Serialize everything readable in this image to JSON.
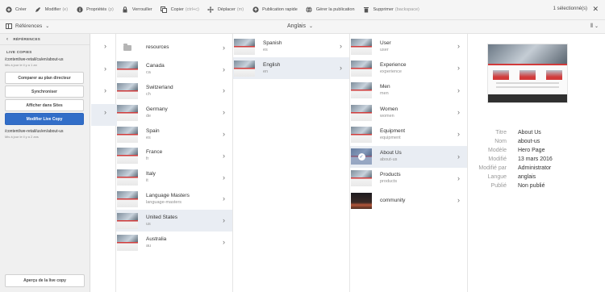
{
  "actions": [
    {
      "icon": "plus-icon",
      "label": "Créer",
      "shortcut": ""
    },
    {
      "icon": "pencil-icon",
      "label": "Modifier",
      "shortcut": "(e)"
    },
    {
      "icon": "info-icon",
      "label": "Propriétés",
      "shortcut": "(p)"
    },
    {
      "icon": "lock-icon",
      "label": "Verrouiller",
      "shortcut": ""
    },
    {
      "icon": "copy-icon",
      "label": "Copier",
      "shortcut": "(ctrl+c)"
    },
    {
      "icon": "move-icon",
      "label": "Déplacer",
      "shortcut": "(m)"
    },
    {
      "icon": "publish-icon",
      "label": "Publication rapide",
      "shortcut": ""
    },
    {
      "icon": "globe-icon",
      "label": "Gérer la publication",
      "shortcut": ""
    },
    {
      "icon": "trash-icon",
      "label": "Supprimer",
      "shortcut": "(backspace)"
    }
  ],
  "selection": {
    "count_label": "1 sélectionné(s)",
    "close": "✕"
  },
  "subbar": {
    "panel_label": "Références",
    "breadcrumb": "Anglais",
    "view_icon": "column-view-icon"
  },
  "rail": {
    "header": "RÉFÉRENCES",
    "section": "LIVE COPIES",
    "copy1_path": "/content/we-retail/ca/en/about-us",
    "copy1_meta": "Mis à jour le il y a 1 an",
    "buttons": [
      "Comparer au plan directeur",
      "Synchroniser",
      "Afficher dans Sites",
      "Modifier Live Copy"
    ],
    "copy2_path": "/content/we-retail/us/en/about-us",
    "copy2_meta": "Mis à jour le il y a 2 ans",
    "bottom_button": "Aperçu de la live copy"
  },
  "col1": [
    {
      "title": "resources",
      "sub": "",
      "thumb": "folder"
    },
    {
      "title": "Canada",
      "sub": "ca",
      "thumb": "page"
    },
    {
      "title": "Switzerland",
      "sub": "ch",
      "thumb": "page"
    },
    {
      "title": "Germany",
      "sub": "de",
      "thumb": "page"
    },
    {
      "title": "Spain",
      "sub": "es",
      "thumb": "page"
    },
    {
      "title": "France",
      "sub": "fr",
      "thumb": "page"
    },
    {
      "title": "Italy",
      "sub": "it",
      "thumb": "page"
    },
    {
      "title": "Language Masters",
      "sub": "language-masters",
      "thumb": "page"
    },
    {
      "title": "United States",
      "sub": "us",
      "thumb": "page",
      "selected": true
    },
    {
      "title": "Australia",
      "sub": "au",
      "thumb": "page"
    }
  ],
  "col2": [
    {
      "title": "Spanish",
      "sub": "es",
      "thumb": "page"
    },
    {
      "title": "English",
      "sub": "en",
      "thumb": "page",
      "selected": true
    }
  ],
  "col3": [
    {
      "title": "User",
      "sub": "user",
      "thumb": "page"
    },
    {
      "title": "Experience",
      "sub": "experience",
      "thumb": "page"
    },
    {
      "title": "Men",
      "sub": "men",
      "thumb": "page"
    },
    {
      "title": "Women",
      "sub": "women",
      "thumb": "page"
    },
    {
      "title": "Equipment",
      "sub": "equipment",
      "thumb": "page"
    },
    {
      "title": "About Us",
      "sub": "about-us",
      "thumb": "page",
      "selected": true,
      "checked": true
    },
    {
      "title": "Products",
      "sub": "products",
      "thumb": "page"
    },
    {
      "title": "community",
      "sub": "",
      "thumb": "dark"
    }
  ],
  "properties": [
    {
      "label": "Titre",
      "value": "About Us"
    },
    {
      "label": "Nom",
      "value": "about-us"
    },
    {
      "label": "Modèle",
      "value": "Hero Page"
    },
    {
      "label": "Modifié",
      "value": "13 mars 2016"
    },
    {
      "label": "Modifié par",
      "value": "Administrator"
    },
    {
      "label": "Langue",
      "value": "anglais"
    },
    {
      "label": "Publié",
      "value": "Non publié"
    }
  ],
  "colors": {
    "accent": "#326ec8",
    "selected_row": "#e9edf3"
  }
}
